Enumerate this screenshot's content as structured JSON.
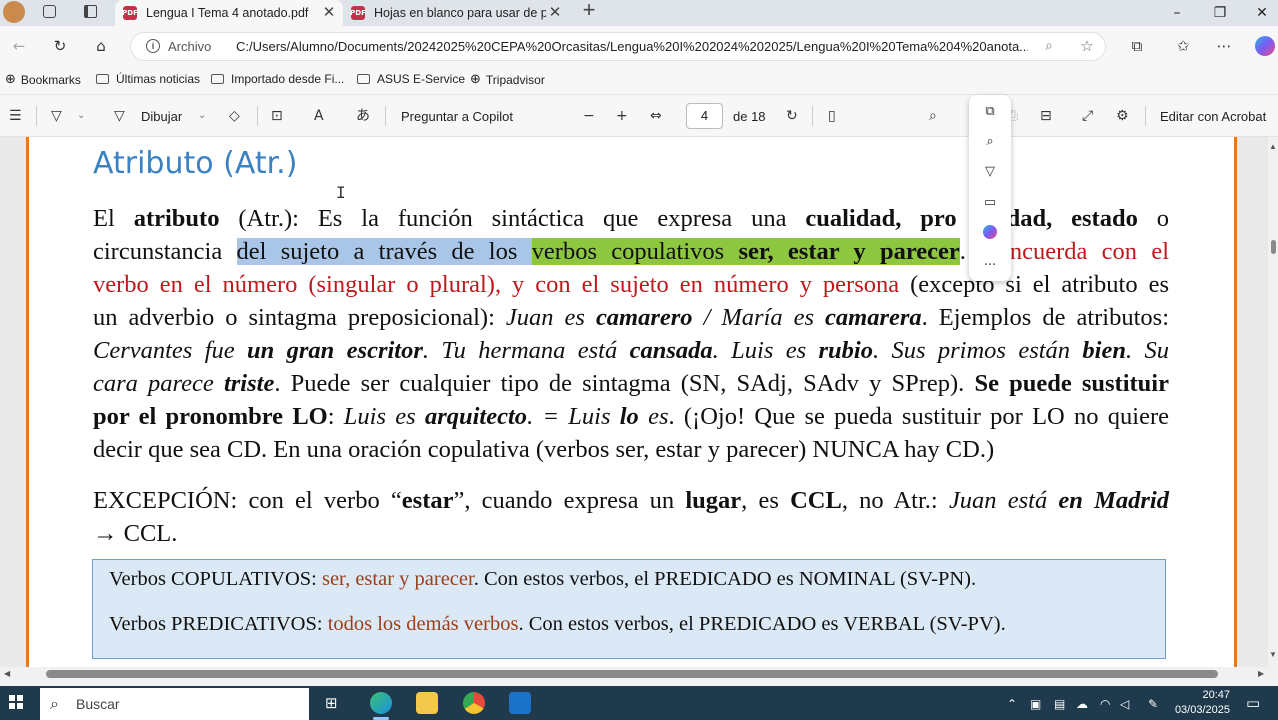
{
  "browser": {
    "tabs": [
      {
        "title": "Lengua I Tema 4 anotado.pdf",
        "active": true
      },
      {
        "title": "Hojas en blanco para usar de piza",
        "active": false
      }
    ],
    "new_tab": "+",
    "window_controls": {
      "minimize": "–",
      "maximize": "❐",
      "close": "✕"
    },
    "address": {
      "label": "Archivo",
      "url": "C:/Users/Alumno/Documents/20242025%20CEPA%20Orcasitas/Lengua%20I%202024%202025/Lengua%20I%20Tema%204%20anota..."
    },
    "bookmarks": [
      "Bookmarks",
      "Últimas noticias",
      "Importado desde Fi...",
      "ASUS E-Service",
      "Tripadvisor"
    ]
  },
  "pdf_toolbar": {
    "draw_label": "Dibujar",
    "copilot_label": "Preguntar a Copilot",
    "page_current": "4",
    "page_total": "de 18",
    "edit_label": "Editar con Acrobat"
  },
  "document": {
    "heading": "Atributo (Atr.)",
    "p1": {
      "l1": {
        "a": "El ",
        "b": "atributo",
        "c": " (Atr.): Es la función sintáctica que expresa una ",
        "d": "cualidad, pro",
        "e": "dad, estado",
        "f": " o"
      },
      "l2": {
        "a": "circunstancia ",
        "hl_blue": "del sujeto a través de los ",
        "hl_green_a": "verbos copulativos ",
        "hl_green_b": "ser, estar y parecer",
        "dot": ".",
        "red": "ncuerda con el"
      },
      "l3": {
        "red": "verbo en el número (singular o plural), y con el sujeto en número y persona",
        "rest": " (excepto si el atributo es"
      },
      "l4": {
        "a": "un adverbio o sintagma preposicional): ",
        "b": "Juan es ",
        "c": "camarero",
        "d": " / María es ",
        "e": "camarera",
        "f": ". Ejemplos de atributos:"
      },
      "l5": {
        "a": "Cervantes fue ",
        "b": "un gran escritor",
        "c": ". Tu hermana está ",
        "d": "cansada",
        "e": ". Luis es ",
        "f": "rubio",
        "g": ". Sus primos están ",
        "h": "bien",
        "i": ". Su"
      },
      "l6": {
        "a": "cara parece ",
        "b": "triste",
        "c": ". Puede ser cualquier tipo de sintagma (SN, SAdj, SAdv y SPrep). ",
        "d": "Se puede sustituir"
      },
      "l7": {
        "a": "por el pronombre LO",
        "b": ": ",
        "c": "Luis es ",
        "d": "arquitecto",
        "e": ". = Luis ",
        "f": "lo",
        "g": " es",
        "h": ". (¡Ojo! Que se pueda sustituir por LO no quiere"
      },
      "l8": "decir que sea CD. En una oración copulativa (verbos ser, estar y parecer) NUNCA hay CD.)"
    },
    "p2": {
      "l1": {
        "a": "EXCEPCIÓN: con el verbo “",
        "b": "estar",
        "c": "”, cuando expresa un ",
        "d": "lugar",
        "e": ", es ",
        "f": "CCL",
        "g": ", no Atr.: ",
        "h": "Juan está ",
        "i": "en Madrid"
      },
      "l2": "→ CCL."
    },
    "box": {
      "l1": {
        "a": "Verbos COPULATIVOS: ",
        "b": "ser, estar y parecer",
        "c": ". Con estos verbos, el PREDICADO es NOMINAL (SV-PN)."
      },
      "l2": {
        "a": "Verbos PREDICATIVOS: ",
        "b": "todos los demás verbos",
        "c": ". Con estos verbos, el PREDICADO es VERBAL (SV-PV)."
      }
    }
  },
  "floating_menu": {
    "more": "..."
  },
  "taskbar": {
    "search_placeholder": "Buscar",
    "time": "20:47",
    "date": "03/03/2025"
  },
  "colors": {
    "heading": "#3b82c4",
    "page_border": "#e07b24",
    "red_text": "#c0181c",
    "highlight_blue": "#a9c6e8",
    "highlight_green": "#8dc63f"
  }
}
